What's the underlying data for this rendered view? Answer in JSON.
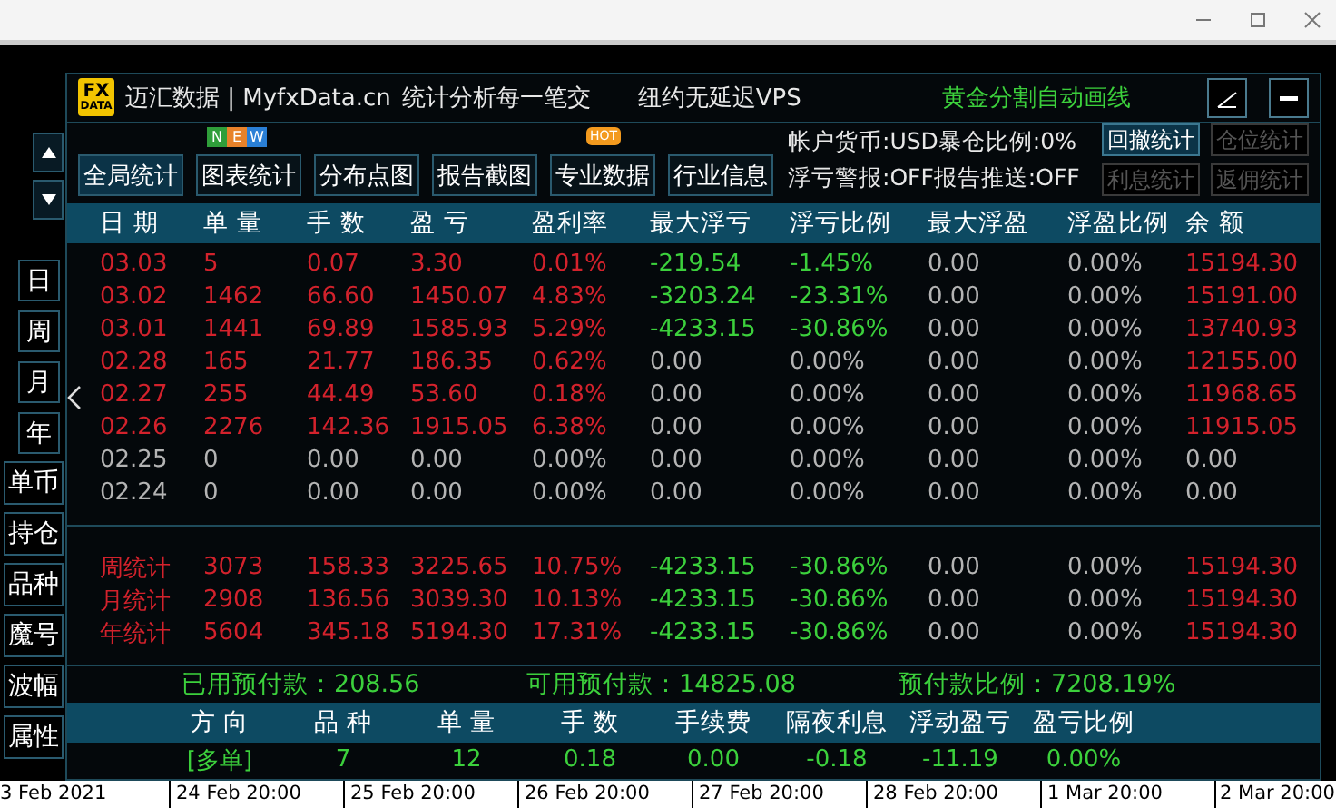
{
  "side_nav": {
    "periods": [
      {
        "label": "日"
      },
      {
        "label": "周"
      },
      {
        "label": "月"
      },
      {
        "label": "年"
      }
    ],
    "filters": [
      {
        "label": "单币"
      },
      {
        "label": "持仓"
      },
      {
        "label": "品种"
      },
      {
        "label": "魔号"
      },
      {
        "label": "波幅"
      },
      {
        "label": "属性"
      }
    ]
  },
  "panel": {
    "logo": {
      "top": "FX",
      "bottom": "DATA"
    },
    "title": "迈汇数据 | MyfxData.cn",
    "slogan": "统计分析每一笔交",
    "vps_link": "纽约无延迟VPS",
    "promo_link": "黄金分割自动画线",
    "toolbar": [
      {
        "label": "全局统计",
        "selected": true
      },
      {
        "label": "图表统计",
        "selected": false,
        "badge": {
          "kind": "new",
          "letters": [
            {
              "text": "N",
              "color": "#2f9e3a"
            },
            {
              "text": "E",
              "color": "#e8822a"
            },
            {
              "text": "W",
              "color": "#2a7fd6"
            }
          ]
        }
      },
      {
        "label": "分布点图",
        "selected": false
      },
      {
        "label": "报告截图",
        "selected": false
      },
      {
        "label": "专业数据",
        "selected": false,
        "badge": {
          "kind": "hot",
          "text": "HOT"
        }
      },
      {
        "label": "行业信息",
        "selected": false
      }
    ],
    "info": [
      "帐户货币:USD暴仓比例:0%",
      "浮亏警报:OFF报告推送:OFF"
    ],
    "stat_buttons": [
      {
        "label": "回撤统计",
        "disabled": false
      },
      {
        "label": "仓位统计",
        "disabled": true
      },
      {
        "label": "利息统计",
        "disabled": true
      },
      {
        "label": "返佣统计",
        "disabled": true
      }
    ],
    "table": {
      "columns": [
        "日 期",
        "单 量",
        "手 数",
        "盈 亏",
        "盈利率",
        "最大浮亏",
        "浮亏比例",
        "最大浮盈",
        "浮盈比例",
        "余 额"
      ],
      "rows": [
        {
          "cells": [
            {
              "text": "03.03",
              "color": "#d3222c"
            },
            {
              "text": "5",
              "color": "#d3222c"
            },
            {
              "text": "0.07",
              "color": "#d3222c"
            },
            {
              "text": "3.30",
              "color": "#d3222c"
            },
            {
              "text": "0.01%",
              "color": "#d3222c"
            },
            {
              "text": "-219.54",
              "color": "#3cd03c"
            },
            {
              "text": "-1.45%",
              "color": "#3cd03c"
            },
            {
              "text": "0.00",
              "color": "#b4b4b4"
            },
            {
              "text": "0.00%",
              "color": "#b4b4b4"
            },
            {
              "text": "15194.30",
              "color": "#d3222c"
            }
          ]
        },
        {
          "cells": [
            {
              "text": "03.02",
              "color": "#d3222c"
            },
            {
              "text": "1462",
              "color": "#d3222c"
            },
            {
              "text": "66.60",
              "color": "#d3222c"
            },
            {
              "text": "1450.07",
              "color": "#d3222c"
            },
            {
              "text": "4.83%",
              "color": "#d3222c"
            },
            {
              "text": "-3203.24",
              "color": "#3cd03c"
            },
            {
              "text": "-23.31%",
              "color": "#3cd03c"
            },
            {
              "text": "0.00",
              "color": "#b4b4b4"
            },
            {
              "text": "0.00%",
              "color": "#b4b4b4"
            },
            {
              "text": "15191.00",
              "color": "#d3222c"
            }
          ]
        },
        {
          "cells": [
            {
              "text": "03.01",
              "color": "#d3222c"
            },
            {
              "text": "1441",
              "color": "#d3222c"
            },
            {
              "text": "69.89",
              "color": "#d3222c"
            },
            {
              "text": "1585.93",
              "color": "#d3222c"
            },
            {
              "text": "5.29%",
              "color": "#d3222c"
            },
            {
              "text": "-4233.15",
              "color": "#3cd03c"
            },
            {
              "text": "-30.86%",
              "color": "#3cd03c"
            },
            {
              "text": "0.00",
              "color": "#b4b4b4"
            },
            {
              "text": "0.00%",
              "color": "#b4b4b4"
            },
            {
              "text": "13740.93",
              "color": "#d3222c"
            }
          ]
        },
        {
          "cells": [
            {
              "text": "02.28",
              "color": "#d3222c"
            },
            {
              "text": "165",
              "color": "#d3222c"
            },
            {
              "text": "21.77",
              "color": "#d3222c"
            },
            {
              "text": "186.35",
              "color": "#d3222c"
            },
            {
              "text": "0.62%",
              "color": "#d3222c"
            },
            {
              "text": "0.00",
              "color": "#b4b4b4"
            },
            {
              "text": "0.00%",
              "color": "#b4b4b4"
            },
            {
              "text": "0.00",
              "color": "#b4b4b4"
            },
            {
              "text": "0.00%",
              "color": "#b4b4b4"
            },
            {
              "text": "12155.00",
              "color": "#d3222c"
            }
          ]
        },
        {
          "cells": [
            {
              "text": "02.27",
              "color": "#d3222c"
            },
            {
              "text": "255",
              "color": "#d3222c"
            },
            {
              "text": "44.49",
              "color": "#d3222c"
            },
            {
              "text": "53.60",
              "color": "#d3222c"
            },
            {
              "text": "0.18%",
              "color": "#d3222c"
            },
            {
              "text": "0.00",
              "color": "#b4b4b4"
            },
            {
              "text": "0.00%",
              "color": "#b4b4b4"
            },
            {
              "text": "0.00",
              "color": "#b4b4b4"
            },
            {
              "text": "0.00%",
              "color": "#b4b4b4"
            },
            {
              "text": "11968.65",
              "color": "#d3222c"
            }
          ]
        },
        {
          "cells": [
            {
              "text": "02.26",
              "color": "#d3222c"
            },
            {
              "text": "2276",
              "color": "#d3222c"
            },
            {
              "text": "142.36",
              "color": "#d3222c"
            },
            {
              "text": "1915.05",
              "color": "#d3222c"
            },
            {
              "text": "6.38%",
              "color": "#d3222c"
            },
            {
              "text": "0.00",
              "color": "#b4b4b4"
            },
            {
              "text": "0.00%",
              "color": "#b4b4b4"
            },
            {
              "text": "0.00",
              "color": "#b4b4b4"
            },
            {
              "text": "0.00%",
              "color": "#b4b4b4"
            },
            {
              "text": "11915.05",
              "color": "#d3222c"
            }
          ]
        },
        {
          "cells": [
            {
              "text": "02.25",
              "color": "#b4b4b4"
            },
            {
              "text": "0",
              "color": "#b4b4b4"
            },
            {
              "text": "0.00",
              "color": "#b4b4b4"
            },
            {
              "text": "0.00",
              "color": "#b4b4b4"
            },
            {
              "text": "0.00%",
              "color": "#b4b4b4"
            },
            {
              "text": "0.00",
              "color": "#b4b4b4"
            },
            {
              "text": "0.00%",
              "color": "#b4b4b4"
            },
            {
              "text": "0.00",
              "color": "#b4b4b4"
            },
            {
              "text": "0.00%",
              "color": "#b4b4b4"
            },
            {
              "text": "0.00",
              "color": "#b4b4b4"
            }
          ]
        },
        {
          "cells": [
            {
              "text": "02.24",
              "color": "#b4b4b4"
            },
            {
              "text": "0",
              "color": "#b4b4b4"
            },
            {
              "text": "0.00",
              "color": "#b4b4b4"
            },
            {
              "text": "0.00",
              "color": "#b4b4b4"
            },
            {
              "text": "0.00%",
              "color": "#b4b4b4"
            },
            {
              "text": "0.00",
              "color": "#b4b4b4"
            },
            {
              "text": "0.00%",
              "color": "#b4b4b4"
            },
            {
              "text": "0.00",
              "color": "#b4b4b4"
            },
            {
              "text": "0.00%",
              "color": "#b4b4b4"
            },
            {
              "text": "0.00",
              "color": "#b4b4b4"
            }
          ]
        }
      ],
      "totals": [
        {
          "cells": [
            {
              "text": "周统计",
              "color": "#d3222c"
            },
            {
              "text": "3073",
              "color": "#d3222c"
            },
            {
              "text": "158.33",
              "color": "#d3222c"
            },
            {
              "text": "3225.65",
              "color": "#d3222c"
            },
            {
              "text": "10.75%",
              "color": "#d3222c"
            },
            {
              "text": "-4233.15",
              "color": "#3cd03c"
            },
            {
              "text": "-30.86%",
              "color": "#3cd03c"
            },
            {
              "text": "0.00",
              "color": "#b4b4b4"
            },
            {
              "text": "0.00%",
              "color": "#b4b4b4"
            },
            {
              "text": "15194.30",
              "color": "#d3222c"
            }
          ]
        },
        {
          "cells": [
            {
              "text": "月统计",
              "color": "#d3222c"
            },
            {
              "text": "2908",
              "color": "#d3222c"
            },
            {
              "text": "136.56",
              "color": "#d3222c"
            },
            {
              "text": "3039.30",
              "color": "#d3222c"
            },
            {
              "text": "10.13%",
              "color": "#d3222c"
            },
            {
              "text": "-4233.15",
              "color": "#3cd03c"
            },
            {
              "text": "-30.86%",
              "color": "#3cd03c"
            },
            {
              "text": "0.00",
              "color": "#b4b4b4"
            },
            {
              "text": "0.00%",
              "color": "#b4b4b4"
            },
            {
              "text": "15194.30",
              "color": "#d3222c"
            }
          ]
        },
        {
          "cells": [
            {
              "text": "年统计",
              "color": "#d3222c"
            },
            {
              "text": "5604",
              "color": "#d3222c"
            },
            {
              "text": "345.18",
              "color": "#d3222c"
            },
            {
              "text": "5194.30",
              "color": "#d3222c"
            },
            {
              "text": "17.31%",
              "color": "#d3222c"
            },
            {
              "text": "-4233.15",
              "color": "#3cd03c"
            },
            {
              "text": "-30.86%",
              "color": "#3cd03c"
            },
            {
              "text": "0.00",
              "color": "#b4b4b4"
            },
            {
              "text": "0.00%",
              "color": "#b4b4b4"
            },
            {
              "text": "15194.30",
              "color": "#d3222c"
            }
          ]
        }
      ]
    },
    "margin": [
      {
        "label": "已用预付款：",
        "value": "208.56"
      },
      {
        "label": "可用预付款：",
        "value": "14825.08"
      },
      {
        "label": "预付款比例：",
        "value": "7208.19%"
      }
    ],
    "positions": {
      "columns": [
        "方 向",
        "品 种",
        "单 量",
        "手 数",
        "手续费",
        "隔夜利息",
        "浮动盈亏",
        "盈亏比例"
      ],
      "rows": [
        {
          "cells": [
            "[多单]",
            "7",
            "12",
            "0.18",
            "0.00",
            "-0.18",
            "-11.19",
            "0.00%"
          ]
        }
      ]
    }
  },
  "time_axis": [
    "3 Feb 2021",
    "24 Feb 20:00",
    "25 Feb 20:00",
    "26 Feb 20:00",
    "27 Feb 20:00",
    "28 Feb 20:00",
    "1 Mar 20:00",
    "2 Mar 20:00"
  ]
}
